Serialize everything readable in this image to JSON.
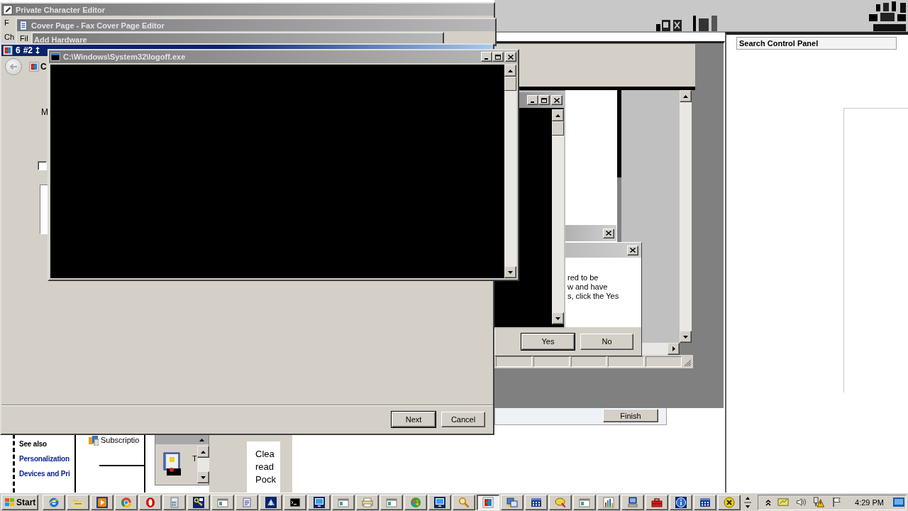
{
  "background_windows": [
    {
      "kind": "editor",
      "title": "Private Character Editor",
      "fragments": [
        "F",
        "Ch"
      ]
    },
    {
      "kind": "fax",
      "title": "Cover Page - Fax Cover Page Editor",
      "fragments": [
        "Fil"
      ]
    },
    {
      "kind": "wizard",
      "title": "Add Hardware"
    }
  ],
  "wizard": {
    "title_fragments": [
      "6",
      "#2"
    ],
    "heading_fragment": "C",
    "label_fragment": "M",
    "checkbox": {
      "checked": false
    },
    "buttons": [
      {
        "label": "Next",
        "default": true
      },
      {
        "label": "Cancel",
        "default": false
      }
    ]
  },
  "console": {
    "title": "C:\\Windows\\System32\\logoff.exe"
  },
  "confirm_dialog": {
    "message_lines": [
      "red to be",
      "w and have",
      "s, click the Yes"
    ],
    "buttons": [
      {
        "label": "Yes",
        "default": true
      },
      {
        "label": "No",
        "default": false
      }
    ]
  },
  "background_dialog": {
    "button": "Finish"
  },
  "control_panel": {
    "search": {
      "placeholder": "Search Control Panel"
    },
    "see_also": {
      "heading": "See also",
      "links": [
        "Personalization",
        "Devices and Pri"
      ]
    },
    "item": "Subscriptio",
    "pane_text": "T",
    "note_lines": [
      "Clea",
      "read",
      "Pock"
    ]
  },
  "taskbar": {
    "start": "Start",
    "buttons": [
      {
        "kind": "globe",
        "selected": false
      },
      {
        "kind": "folder",
        "selected": false
      },
      {
        "kind": "media",
        "selected": false
      },
      {
        "kind": "wheel",
        "selected": false
      },
      {
        "kind": "ring",
        "selected": false
      },
      {
        "kind": "calculator",
        "selected": false
      },
      {
        "kind": "keys",
        "selected": false
      },
      {
        "kind": "window",
        "selected": false
      },
      {
        "kind": "document",
        "selected": false
      },
      {
        "kind": "app",
        "selected": false
      },
      {
        "kind": "console",
        "selected": false
      },
      {
        "kind": "monitor",
        "selected": false
      },
      {
        "kind": "window",
        "selected": false
      },
      {
        "kind": "printer",
        "selected": false
      },
      {
        "kind": "window",
        "selected": false
      },
      {
        "kind": "orb",
        "selected": false
      },
      {
        "kind": "monitor",
        "selected": false
      },
      {
        "kind": "magnifier",
        "selected": false
      },
      {
        "kind": "font",
        "selected": true
      },
      {
        "kind": "apps",
        "selected": false
      },
      {
        "kind": "grid",
        "selected": false
      },
      {
        "kind": "hand",
        "selected": false
      },
      {
        "kind": "window",
        "selected": false
      },
      {
        "kind": "chart",
        "selected": false
      },
      {
        "kind": "computer",
        "selected": false
      },
      {
        "kind": "toolbox",
        "selected": false
      },
      {
        "kind": "info",
        "selected": false
      },
      {
        "kind": "grid",
        "selected": false
      },
      {
        "kind": "cancel",
        "selected": false
      }
    ],
    "clock": "4:29 PM"
  }
}
